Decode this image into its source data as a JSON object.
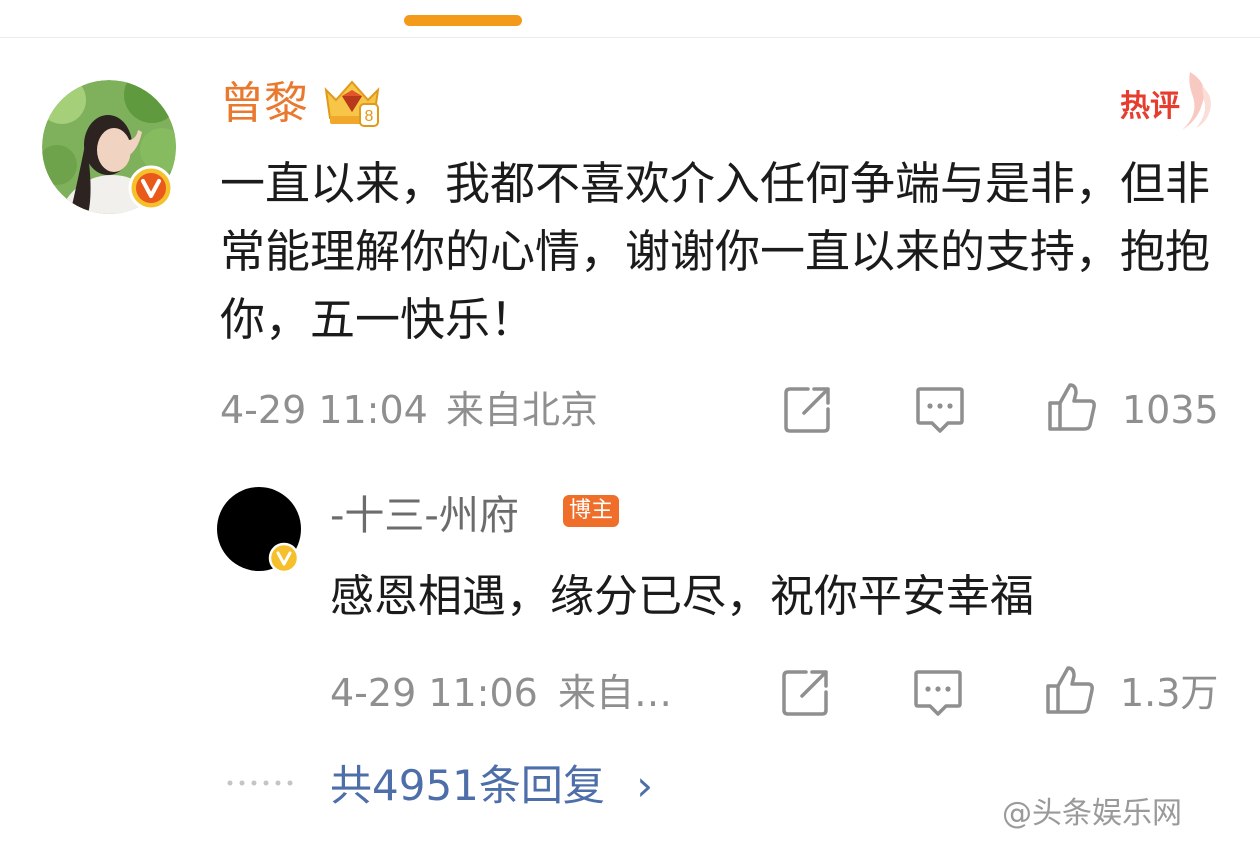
{
  "colors": {
    "accent_orange": "#f39a1b",
    "username": "#e8792e",
    "hot_red": "#e63d2e",
    "link_blue": "#4d6ea8",
    "meta_gray": "#8f8f8f",
    "host_badge_bg": "#ef6e2a"
  },
  "comment": {
    "username": "曾黎",
    "badge_icon": "crown-icon",
    "verified_icon": "verified-v-icon",
    "hot_label": "热评",
    "text": "一直以来，我都不喜欢介入任何争端与是非，但非常能理解你的心情，谢谢你一直以来的支持，抱抱你，五一快乐！",
    "timestamp": "4-29 11:04",
    "location": "来自北京",
    "likes": "1035"
  },
  "reply": {
    "username": "-十三-州府",
    "host_badge": "博主",
    "text": "感恩相遇，缘分已尽，祝你平安幸福",
    "timestamp": "4-29 11:06",
    "location": "来自…",
    "likes": "1.3万"
  },
  "more_replies": {
    "label": "共4951条回复",
    "chevron": "›"
  },
  "watermark": "@头条娱乐网",
  "icons": [
    "share-icon",
    "comment-icon",
    "like-icon"
  ]
}
